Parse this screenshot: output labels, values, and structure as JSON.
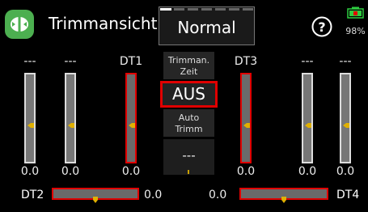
{
  "header": {
    "title": "Trimmansicht",
    "mode": "Normal",
    "battery_percent": "98%"
  },
  "icons": {
    "app": "trim-app-icon",
    "help": "help-icon",
    "battery": "battery-icon"
  },
  "colors": {
    "selection": "#e00000",
    "app_icon": "#4caf50",
    "marker": "#e0b000",
    "battery": "#2ecc40"
  },
  "vertical_trims": [
    {
      "label": "---",
      "value": "0.0",
      "selected": false,
      "level": 0.5
    },
    {
      "label": "---",
      "value": "0.0",
      "selected": false,
      "level": 0.5
    },
    {
      "label": "DT1",
      "value": "0.0",
      "selected": true,
      "level": 0.5
    },
    {
      "label": "DT3",
      "value": "0.0",
      "selected": true,
      "level": 0.5
    },
    {
      "label": "---",
      "value": "0.0",
      "selected": false,
      "level": 0.5
    },
    {
      "label": "---",
      "value": "0.0",
      "selected": false,
      "level": 0.5
    }
  ],
  "center": {
    "trim_time_label_line1": "Trimman.",
    "trim_time_label_line2": "Zeit",
    "trim_time_value": "AUS",
    "auto_trim_label_line1": "Auto",
    "auto_trim_label_line2": "Trimm",
    "auto_trim_value": "---"
  },
  "horizontal_trims": [
    {
      "label": "DT2",
      "value": "0.0",
      "selected": true,
      "level": 0.5
    },
    {
      "label": "DT4",
      "value": "0.0",
      "selected": true,
      "level": 0.5
    }
  ]
}
